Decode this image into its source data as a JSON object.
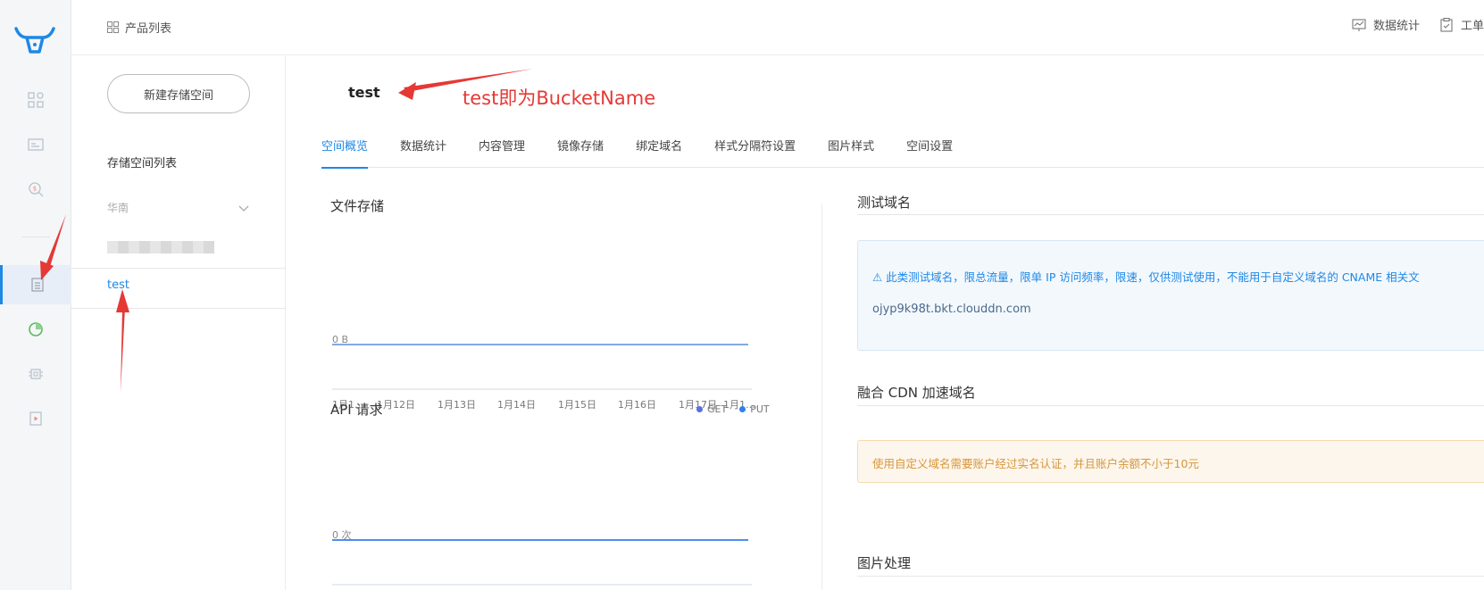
{
  "header": {
    "breadcrumb": "产品列表",
    "stats_label": "数据统计",
    "ticket_label": "工单"
  },
  "sidebar": {
    "new_bucket_label": "新建存储空间",
    "list_title": "存储空间列表",
    "region_label": "华南",
    "bucket_name": "test"
  },
  "main": {
    "bucket_title": "test",
    "annotation": "test即为BucketName",
    "tabs": [
      {
        "label": "空间概览",
        "active": true
      },
      {
        "label": "数据统计",
        "active": false
      },
      {
        "label": "内容管理",
        "active": false
      },
      {
        "label": "镜像存储",
        "active": false
      },
      {
        "label": "绑定域名",
        "active": false
      },
      {
        "label": "样式分隔符设置",
        "active": false
      },
      {
        "label": "图片样式",
        "active": false
      },
      {
        "label": "空间设置",
        "active": false
      }
    ]
  },
  "storage_chart": {
    "title": "文件存储",
    "y_label": "0 B"
  },
  "api_chart": {
    "title": "API 请求",
    "y_label": "0 次"
  },
  "right": {
    "test_domain_title": "测试域名",
    "test_domain_warning": "⚠ 此类测试域名，限总流量，限单 IP 访问频率，限速，仅供测试使用，不能用于自定义域名的 CNAME 相关文",
    "test_domain_value": "ojyp9k98t.bkt.clouddn.com",
    "cdn_title": "融合 CDN 加速域名",
    "cdn_warning": "使用自定义域名需要账户经过实名认证，并且账户余额不小于10元",
    "image_title": "图片处理"
  },
  "colors": {
    "accent": "#1e88e5",
    "annotation": "#e53935",
    "get_series": "#5b6ee1",
    "put_series": "#2f80ed"
  },
  "chart_data": [
    {
      "type": "line",
      "title": "文件存储",
      "categories": [
        "1月1…",
        "1月12日",
        "1月13日",
        "1月14日",
        "1月15日",
        "1月16日",
        "1月17日",
        "1月1…"
      ],
      "series": [
        {
          "values": [
            0,
            0,
            0,
            0,
            0,
            0,
            0,
            0
          ]
        }
      ],
      "ytick": "0 B",
      "ylim": [
        0,
        0
      ],
      "grid": false
    },
    {
      "type": "line",
      "title": "API 请求",
      "categories": [
        "1月1…",
        "1月12日",
        "1月13日",
        "1月14日",
        "1月15日",
        "1月16日",
        "1月17日",
        "1月1…"
      ],
      "series": [
        {
          "name": "GET",
          "values": [
            0,
            0,
            0,
            0,
            0,
            0,
            0,
            0
          ]
        },
        {
          "name": "PUT",
          "values": [
            0,
            0,
            0,
            0,
            0,
            0,
            0,
            0
          ]
        }
      ],
      "ytick": "0 次",
      "ylim": [
        0,
        0
      ],
      "legend": "top-right",
      "grid": false
    }
  ]
}
